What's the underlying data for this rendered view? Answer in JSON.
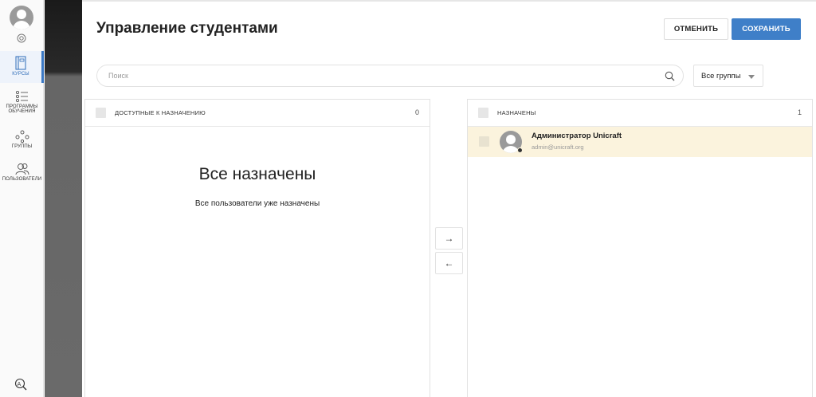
{
  "page": {
    "title": "Управление студентами",
    "cancel_label": "ОТМЕНИТЬ",
    "save_label": "СОХРАНИТЬ"
  },
  "sidebar": {
    "items": [
      {
        "label": "КУРСЫ",
        "icon": "book-icon",
        "active": true
      },
      {
        "label_line1": "ПРОГРАММЫ",
        "label_line2": "ОБУЧЕНИЯ",
        "icon": "list-icon"
      },
      {
        "label": "ГРУППЫ",
        "icon": "groups-icon"
      },
      {
        "label": "ПОЛЬЗОВАТЕЛИ",
        "icon": "users-icon"
      }
    ]
  },
  "search": {
    "placeholder": "Поиск"
  },
  "group_filter": {
    "selected": "Все группы"
  },
  "available_panel": {
    "title": "ДОСТУПНЫЕ К НАЗНАЧЕНИЮ",
    "count": "0",
    "empty_title": "Все назначены",
    "empty_subtitle": "Все пользователи уже назначены"
  },
  "assigned_panel": {
    "title": "НАЗНАЧЕНЫ",
    "count": "1",
    "users": [
      {
        "name": "Администратор Unicraft",
        "email": "admin@unicraft.org"
      }
    ]
  },
  "arrows": {
    "right": "→",
    "left": "←"
  },
  "colors": {
    "accent": "#3f7fc8",
    "highlight_row": "#fbf3dd"
  }
}
